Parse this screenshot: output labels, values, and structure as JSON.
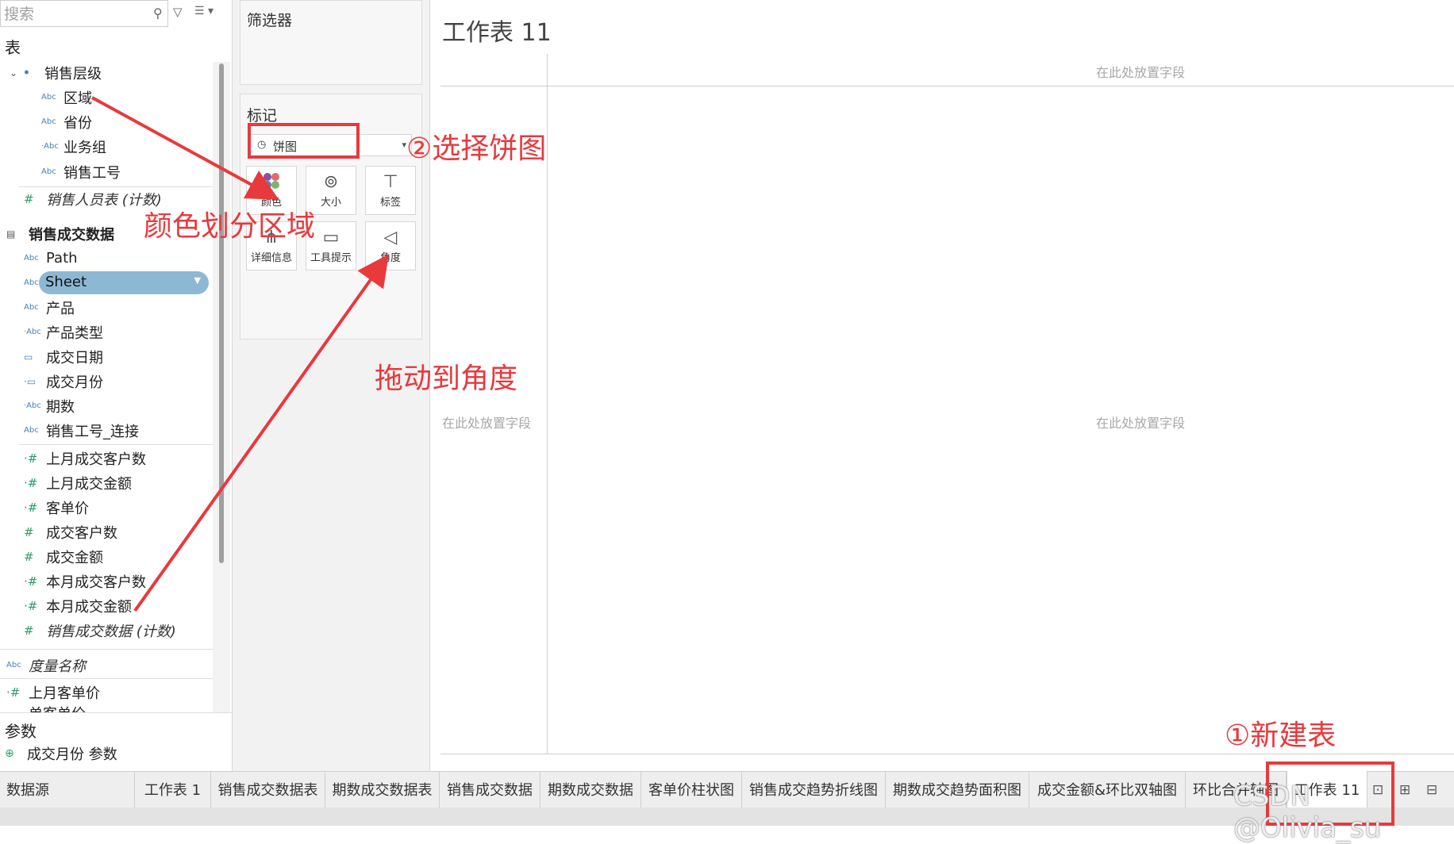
{
  "search": {
    "placeholder": "搜索"
  },
  "data_pane": {
    "tables_title": "表",
    "hierarchy": "销售层级",
    "hierarchy_fields": [
      "区域",
      "省份",
      "业务组",
      "销售工号"
    ],
    "count1": "销售人员表 (计数)",
    "table2": "销售成交数据",
    "dims": [
      "Path",
      "Sheet",
      "产品",
      "产品类型",
      "成交日期",
      "成交月份",
      "期数",
      "销售工号_连接"
    ],
    "measures": [
      "上月成交客户数",
      "上月成交金额",
      "客单价",
      "成交客户数",
      "成交金额",
      "本月成交客户数",
      "本月成交金额"
    ],
    "count2": "销售成交数据 (计数)",
    "measure_names": "度量名称",
    "calc_field": "上月客单价",
    "cut_field": "单客单价",
    "params_title": "参数",
    "param": "成交月份 参数"
  },
  "cards": {
    "filters": "筛选器",
    "marks": "标记",
    "mark_type": "饼图",
    "buttons": {
      "color": "颜色",
      "size": "大小",
      "label": "标签",
      "detail": "详细信息",
      "tooltip": "工具提示",
      "angle": "角度"
    }
  },
  "canvas": {
    "title": "工作表 11",
    "drop_top": "在此处放置字段",
    "drop_left": "在此处放置字段",
    "drop_center": "在此处放置字段"
  },
  "tabs": [
    "数据源",
    "工作表 1",
    "销售成交数据表",
    "期数成交数据表",
    "销售成交数据",
    "期数成交数据",
    "客单价柱状图",
    "销售成交趋势折线图",
    "期数成交趋势面积图",
    "成交金额&环比双轴图",
    "环比合并轴图",
    "工作表 11"
  ],
  "annotations": {
    "step1": "①新建表",
    "step2": "②选择饼图",
    "color_note": "颜色划分区域",
    "drag_note": "拖动到角度"
  },
  "watermark": "CSDN @Olivia_su",
  "colors": {
    "annotation": "#e8393d",
    "selected_pill": "#8db8d4"
  }
}
